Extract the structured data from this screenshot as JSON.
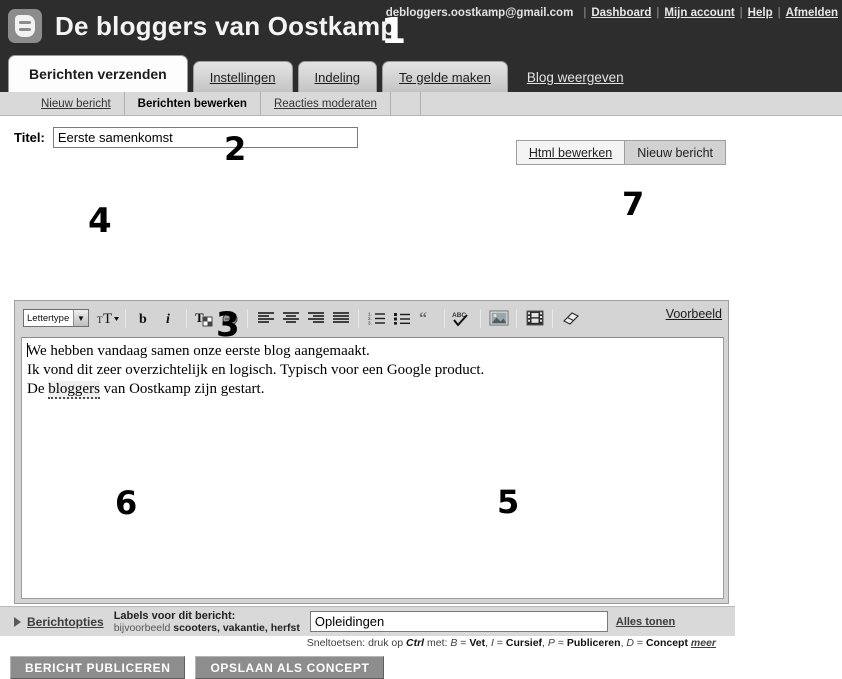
{
  "header": {
    "blog_title": "De bloggers van Oostkamp",
    "logo_icon": "blogger-logo-icon",
    "account_email": "debloggers.oostkamp@gmail.com",
    "links": [
      "Dashboard",
      "Mijn account",
      "Help",
      "Afmelden"
    ],
    "separator": "|",
    "bg_color": "#2d2d2d"
  },
  "primary_tabs": [
    {
      "label": "Berichten verzenden",
      "active": true
    },
    {
      "label": "Instellingen",
      "active": false
    },
    {
      "label": "Indeling",
      "active": false
    },
    {
      "label": "Te gelde maken",
      "active": false
    },
    {
      "label": "Blog weergeven",
      "active": false,
      "plain": true
    }
  ],
  "secondary_tabs": [
    {
      "label": "Nieuw bericht",
      "active": false
    },
    {
      "label": "Berichten bewerken",
      "active": true
    },
    {
      "label": "Reacties moderaten",
      "active": false
    }
  ],
  "title_field": {
    "label": "Titel:",
    "value": "Eerste samenkomst",
    "placeholder": ""
  },
  "mode_tabs": [
    {
      "label": "Html bewerken",
      "selected": false
    },
    {
      "label": "Nieuw bericht",
      "selected": true
    }
  ],
  "toolbar": {
    "font_select_value": "Lettertype",
    "font_select_arrow": "chevron-down-icon",
    "buttons": [
      {
        "name": "font-size-icon",
        "title": "Lettergrootte"
      },
      {
        "name": "bold-icon",
        "title": "Vet"
      },
      {
        "name": "italic-icon",
        "title": "Cursief"
      },
      {
        "name": "text-color-icon",
        "title": "Tekstkleur"
      },
      {
        "name": "link-icon",
        "title": "Koppeling"
      },
      {
        "name": "align-left-icon",
        "title": "Links uitlijnen"
      },
      {
        "name": "align-center-icon",
        "title": "Centreren"
      },
      {
        "name": "align-right-icon",
        "title": "Rechts uitlijnen"
      },
      {
        "name": "align-justify-icon",
        "title": "Uitvullen"
      },
      {
        "name": "numbered-list-icon",
        "title": "Genummerde lijst"
      },
      {
        "name": "bullet-list-icon",
        "title": "Lijst met opsommingstekens"
      },
      {
        "name": "blockquote-icon",
        "title": "Citaat"
      },
      {
        "name": "spellcheck-icon",
        "title": "Spelling controleren"
      },
      {
        "name": "image-icon",
        "title": "Afbeelding toevoegen"
      },
      {
        "name": "video-icon",
        "title": "Video toevoegen"
      },
      {
        "name": "eraser-icon",
        "title": "Opmaak verwijderen"
      }
    ],
    "preview_label": "Voorbeeld"
  },
  "editor_body": {
    "lines": [
      "We hebben vandaag samen onze eerste blog aangemaakt.",
      "Ik vond dit zeer overzichtelijk en logisch. Typisch voor een Google product."
    ],
    "line3_prefix": "De ",
    "line3_misspelled": "bloggers",
    "line3_suffix": " van Oostkamp zijn gestart."
  },
  "labels_section": {
    "post_options_label": "Berichtopties",
    "disclosure_icon": "triangle-right-icon",
    "heading": "Labels voor dit bericht:",
    "example_prefix": "bijvoorbeeld ",
    "example_labels": "scooters, vakantie, herfst",
    "input_value": "Opleidingen",
    "show_all_label": "Alles tonen"
  },
  "shortcuts": {
    "prefix": "Sneltoetsen: druk op ",
    "ctrl": "Ctrl",
    "met": " met: ",
    "b_key": "B",
    "b_eq": " = ",
    "b_val": "Vet",
    "i_key": "I",
    "i_val": "Cursief",
    "p_key": "P",
    "p_val": "Publiceren",
    "d_key": "D",
    "d_val": "Concept",
    "comma": ", ",
    "more": "meer"
  },
  "actions": [
    {
      "label": "BERICHT PUBLICEREN"
    },
    {
      "label": "OPSLAAN ALS CONCEPT"
    }
  ],
  "annotations": {
    "n1": "1",
    "n2": "2",
    "n3": "3",
    "n4": "4",
    "n5": "5",
    "n6": "6",
    "n7": "7"
  }
}
